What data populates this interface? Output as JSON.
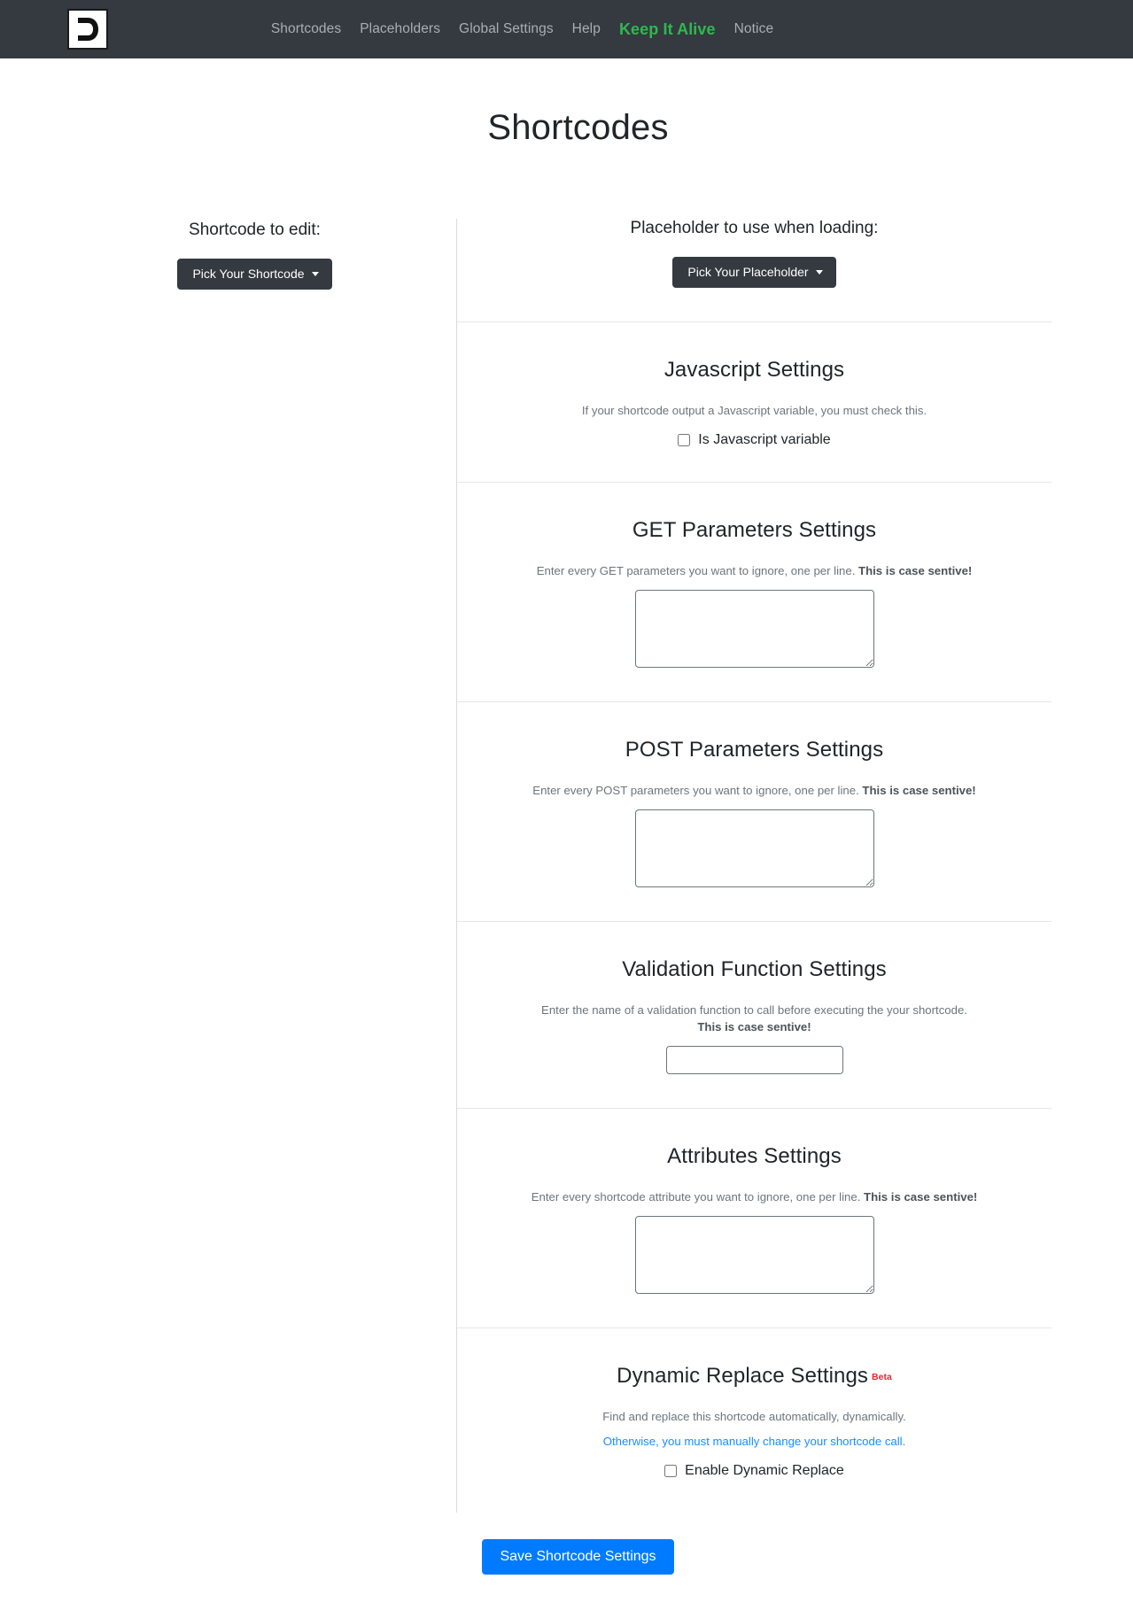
{
  "navbar": {
    "logo_alt": "brand-logo",
    "links": [
      {
        "label": "Shortcodes",
        "style": "muted"
      },
      {
        "label": "Placeholders",
        "style": "muted"
      },
      {
        "label": "Global Settings",
        "style": "muted"
      },
      {
        "label": "Help",
        "style": "muted"
      },
      {
        "label": "Keep It Alive",
        "style": "accent"
      },
      {
        "label": "Notice",
        "style": "muted"
      }
    ],
    "background_color": "#343a40",
    "link_color": "#a9aeb3",
    "accent_color": "#2fb84f"
  },
  "page": {
    "title": "Shortcodes"
  },
  "left_column": {
    "label": "Shortcode to edit:",
    "dropdown_label": "Pick Your Shortcode"
  },
  "right_column": {
    "placeholder_label": "Placeholder to use when loading:",
    "placeholder_dropdown_label": "Pick Your Placeholder",
    "sections": {
      "javascript": {
        "title": "Javascript Settings",
        "helper": "If your shortcode output a Javascript variable, you must check this.",
        "checkbox_label": "Is Javascript variable",
        "checkbox_checked": false
      },
      "get_parameters": {
        "title": "GET Parameters Settings",
        "helper_normal": "Enter every GET parameters you want to ignore, one per line. ",
        "helper_bold": "This is case sentive!",
        "textarea_value": "",
        "textarea_placeholder": ""
      },
      "post_parameters": {
        "title": "POST Parameters Settings",
        "helper_normal": "Enter every POST parameters you want to ignore, one per line. ",
        "helper_bold": "This is case sentive!",
        "textarea_value": "",
        "textarea_placeholder": ""
      },
      "validation_function": {
        "title": "Validation Function Settings",
        "helper_normal": "Enter the name of a validation function to call before executing the your shortcode. ",
        "helper_bold": "This is case sentive!",
        "input_value": "",
        "input_placeholder": ""
      },
      "attributes": {
        "title": "Attributes Settings",
        "helper_normal": "Enter every shortcode attribute you want to ignore, one per line. ",
        "helper_bold": "This is case sentive!",
        "textarea_value": "",
        "textarea_placeholder": ""
      },
      "dynamic_replace": {
        "title": "Dynamic Replace Settings",
        "badge": "Beta",
        "badge_color": "#e8262c",
        "helper": "Find and replace this shortcode automatically, dynamically.",
        "helper_link": "Otherwise, you must manually change your shortcode call.",
        "link_color": "#1a8cff",
        "checkbox_label": "Enable Dynamic Replace",
        "checkbox_checked": false
      }
    }
  },
  "footer": {
    "save_label": "Save Shortcode Settings",
    "save_color": "#007bff"
  }
}
